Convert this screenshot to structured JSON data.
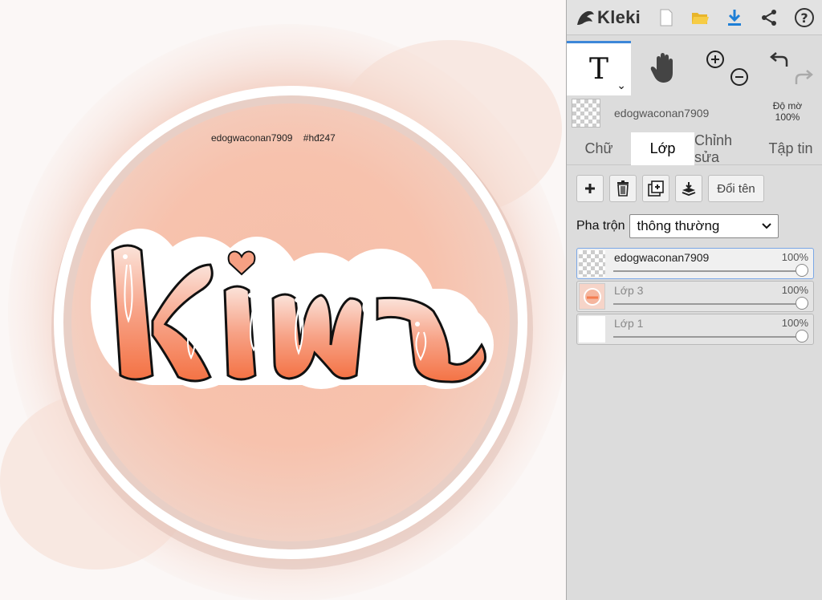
{
  "app": {
    "name": "Kleki"
  },
  "canvas": {
    "signature_user": "edogwaconan7909",
    "signature_tag": "#hđ247",
    "artwork_text": "Kiwi",
    "colors": {
      "peach": "#f7b8a2",
      "orange": "#f47c4e",
      "ring": "#ffffff",
      "outline": "#111111"
    }
  },
  "toolbar": {
    "buttons": [
      "new-file-icon",
      "open-folder-icon",
      "download-icon",
      "share-icon",
      "help-icon"
    ]
  },
  "tools": {
    "text_glyph": "T",
    "items": [
      "text-tool",
      "hand-tool",
      "zoom-in-out",
      "undo-redo"
    ]
  },
  "active_layer": {
    "name": "edogwaconan7909",
    "opacity_label": "Độ mờ",
    "opacity_value": "100%"
  },
  "tabs": [
    {
      "label": "Chữ",
      "active": false
    },
    {
      "label": "Lớp",
      "active": true
    },
    {
      "label": "Chỉnh sửa",
      "active": false
    },
    {
      "label": "Tập tin",
      "active": false
    }
  ],
  "layer_actions": {
    "rename_label": "Đổi tên"
  },
  "blend": {
    "label": "Pha trộn",
    "value": "thông thường"
  },
  "layers": [
    {
      "name": "edogwaconan7909",
      "opacity": "100%",
      "selected": true
    },
    {
      "name": "Lớp 3",
      "opacity": "100%",
      "selected": false
    },
    {
      "name": "Lớp 1",
      "opacity": "100%",
      "selected": false
    }
  ],
  "accent_color": "#3d87d8"
}
